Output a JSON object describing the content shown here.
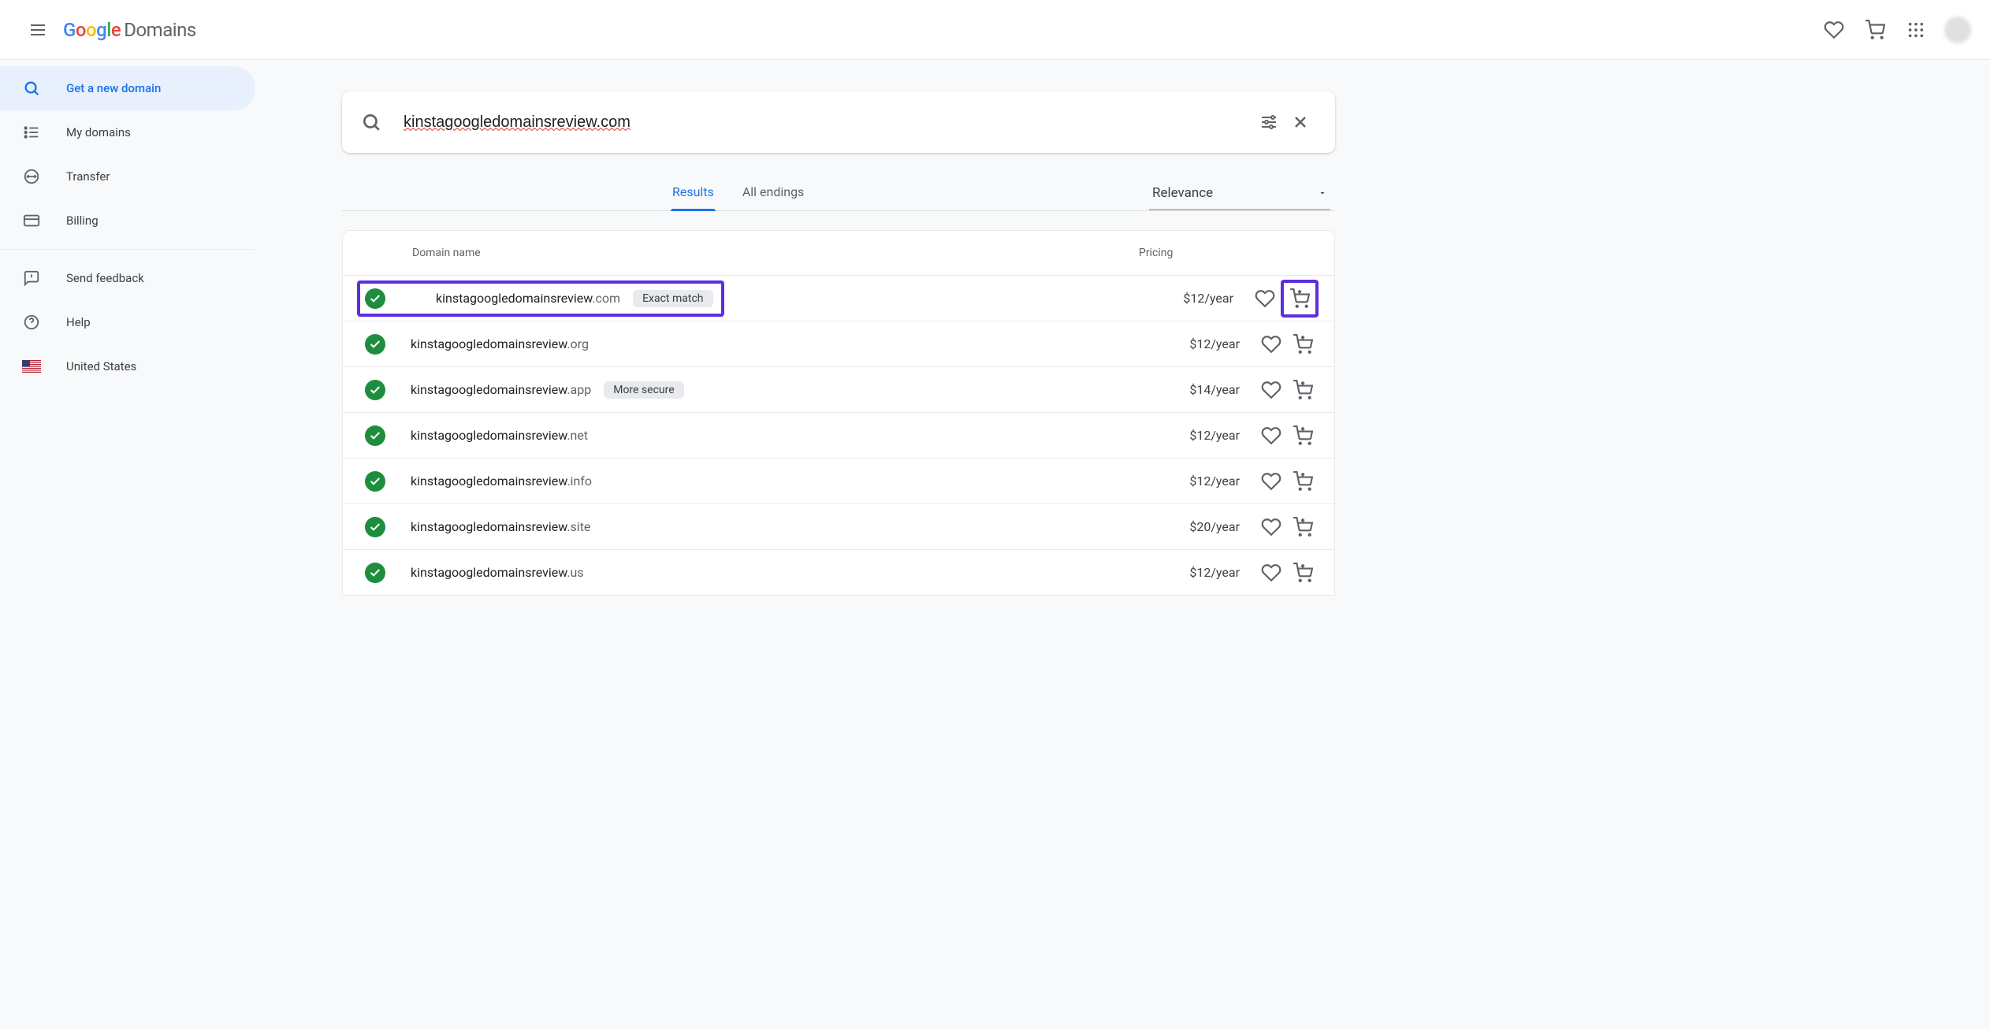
{
  "header": {
    "logo_product": "Domains"
  },
  "sidebar": {
    "items": [
      {
        "label": "Get a new domain"
      },
      {
        "label": "My domains"
      },
      {
        "label": "Transfer"
      },
      {
        "label": "Billing"
      },
      {
        "label": "Send feedback"
      },
      {
        "label": "Help"
      },
      {
        "label": "United States"
      }
    ]
  },
  "search": {
    "query": "kinstagoogledomainsreview.com"
  },
  "tabs": {
    "results": "Results",
    "endings": "All endings"
  },
  "sort": {
    "value": "Relevance"
  },
  "table": {
    "header_name": "Domain name",
    "header_price": "Pricing"
  },
  "results": [
    {
      "sld": "kinstagoogledomainsreview",
      "tld": ".com",
      "badge": "Exact match",
      "price": "$12/year"
    },
    {
      "sld": "kinstagoogledomainsreview",
      "tld": ".org",
      "badge": null,
      "price": "$12/year"
    },
    {
      "sld": "kinstagoogledomainsreview",
      "tld": ".app",
      "badge": "More secure",
      "price": "$14/year"
    },
    {
      "sld": "kinstagoogledomainsreview",
      "tld": ".net",
      "badge": null,
      "price": "$12/year"
    },
    {
      "sld": "kinstagoogledomainsreview",
      "tld": ".info",
      "badge": null,
      "price": "$12/year"
    },
    {
      "sld": "kinstagoogledomainsreview",
      "tld": ".site",
      "badge": null,
      "price": "$20/year"
    },
    {
      "sld": "kinstagoogledomainsreview",
      "tld": ".us",
      "badge": null,
      "price": "$12/year"
    }
  ]
}
